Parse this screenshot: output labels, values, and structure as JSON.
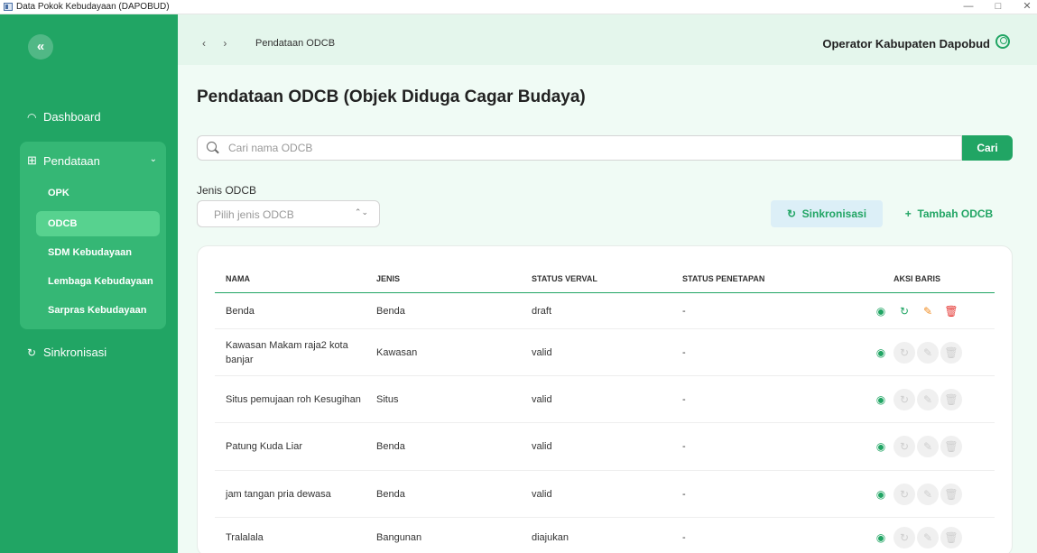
{
  "window": {
    "title": "Data Pokok Kebudayaan (DAPOBUD)",
    "minimize": "—",
    "maximize": "□",
    "close": "✕"
  },
  "sidebar": {
    "collapse_icon": "«",
    "dashboard": {
      "icon": "dashboard-icon",
      "label": "Dashboard"
    },
    "pendataan": {
      "icon": "table-icon",
      "label": "Pendataan"
    },
    "sub_items": [
      {
        "label": "OPK",
        "active": false
      },
      {
        "label": "ODCB",
        "active": true
      },
      {
        "label": "SDM Kebudayaan",
        "active": false
      },
      {
        "label": "Lembaga Kebudayaan",
        "active": false
      },
      {
        "label": "Sarpras Kebudayaan",
        "active": false
      }
    ],
    "sinkronisasi": {
      "icon": "sync-icon",
      "label": "Sinkronisasi"
    }
  },
  "header": {
    "back": "‹",
    "forward": "›",
    "breadcrumb": "Pendataan ODCB",
    "user": "Operator Kabupaten Dapobud"
  },
  "main": {
    "title": "Pendataan ODCB (Objek Diduga Cagar Budaya)",
    "search": {
      "placeholder": "Cari nama ODCB",
      "value": "",
      "button": "Cari"
    },
    "filter": {
      "label": "Jenis ODCB",
      "placeholder": "Pilih jenis ODCB"
    },
    "sync_button": "Sinkronisasi",
    "add_button": "Tambah ODCB"
  },
  "table": {
    "headers": [
      "NAMA",
      "JENIS",
      "STATUS VERVAL",
      "STATUS PENETAPAN",
      "AKSI BARIS"
    ],
    "rows": [
      {
        "nama": "Benda",
        "jenis": "Benda",
        "verval": "draft",
        "penetapan": "-",
        "enabled": true
      },
      {
        "nama": "Kawasan Makam raja2 kota banjar",
        "jenis": "Kawasan",
        "verval": "valid",
        "penetapan": "-",
        "enabled": false
      },
      {
        "nama": "Situs pemujaan roh Kesugihan",
        "jenis": "Situs",
        "verval": "valid",
        "penetapan": "-",
        "enabled": false
      },
      {
        "nama": "Patung Kuda Liar",
        "jenis": "Benda",
        "verval": "valid",
        "penetapan": "-",
        "enabled": false
      },
      {
        "nama": "jam tangan pria dewasa",
        "jenis": "Benda",
        "verval": "valid",
        "penetapan": "-",
        "enabled": false
      },
      {
        "nama": "Tralalala",
        "jenis": "Bangunan",
        "verval": "diajukan",
        "penetapan": "-",
        "enabled": false
      }
    ]
  },
  "colors": {
    "primary": "#21a564",
    "sidebar_group": "#35b775",
    "active_item": "#57d28f",
    "edit": "#f08c22",
    "delete": "#e53935"
  }
}
